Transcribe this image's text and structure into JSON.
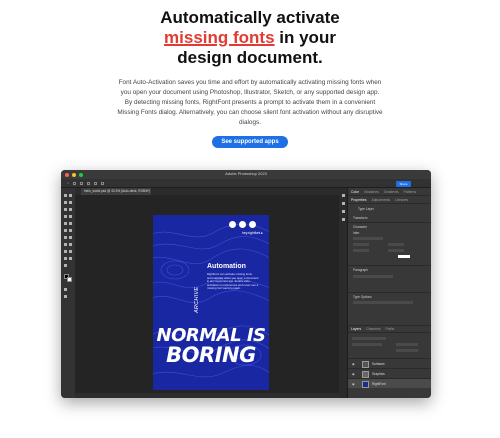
{
  "hero": {
    "title_line1": "Automatically activate",
    "title_highlight": "missing fonts",
    "title_line2_rest": " in your",
    "title_line3": "design document.",
    "description": "Font Auto-Activation saves you time and effort by automatically activating missing fonts when you open your document using Photoshop, Illustrator, Sketch, or any supported design app. By detecting missing fonts, RightFont presents a prompt to activate them in a convenient Missing Fonts dialog. Alternatively, you can choose silent font activation without any disruptive dialogs.",
    "cta_label": "See supported apps"
  },
  "app": {
    "window_title": "Adobe Photoshop 2023",
    "doc_tab": "hello_world.psd @ 33.3% (Auto-desk, RGB/8*)",
    "share_label": "Share",
    "panel_tabs": [
      "Color",
      "Swatches",
      "Gradients",
      "Patterns"
    ],
    "props_tabs": [
      "Properties",
      "Adjustments",
      "Libraries"
    ],
    "props_type": "Type Layer",
    "section_transform": "Transform",
    "section_character": "Character",
    "section_paragraph": "Paragraph",
    "section_typeoptions": "Type Options",
    "layers_tabs": [
      "Layers",
      "Channels",
      "Paths"
    ],
    "layers": [
      "Surfaces",
      "Graphics",
      "RightFont"
    ],
    "font_family": "Inter",
    "colors": {
      "accent": "#1f6fe5",
      "highlight": "#e23b33",
      "poster": "#1a27a3"
    }
  },
  "poster": {
    "handle": "hey.rightfont ▸",
    "heading": "Automation",
    "body": "RightFont can activate missing fonts automatically when you open a document in any supported app. Enable auto-activation in preferences and never see a missing font warning again.",
    "vertical": "ARCHIVE",
    "line1": "NORMAL IS",
    "line2": "BORING"
  }
}
